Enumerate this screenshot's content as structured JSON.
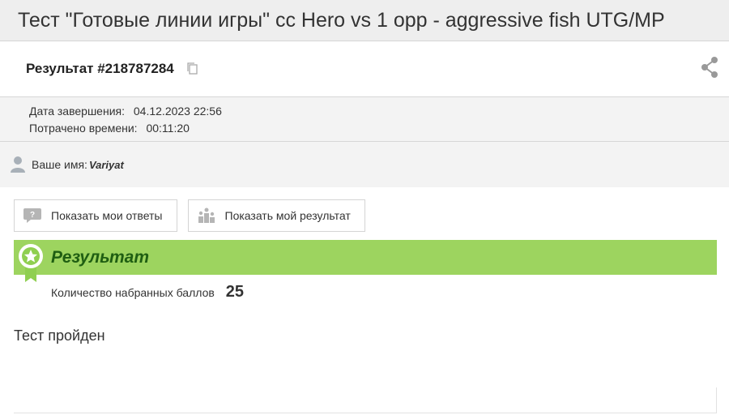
{
  "header": {
    "title": "Тест \"Готовые линии игры\" сс Hero vs 1 opp - aggressive fish UTG/MP"
  },
  "result": {
    "label": "Результат #218787284"
  },
  "meta": {
    "finish_label": "Дата завершения:",
    "finish_value": "04.12.2023 22:56",
    "spent_label": "Потрачено времени:",
    "spent_value": "00:11:20"
  },
  "user": {
    "label": "Ваше имя:",
    "name": "Variyat"
  },
  "buttons": {
    "show_answers": "Показать мои ответы",
    "show_result": "Показать мой результат"
  },
  "result_block": {
    "title": "Результат",
    "score_label": "Количество набранных баллов",
    "score_value": "25",
    "status": "Тест пройден"
  },
  "colors": {
    "accent_green": "#9dd45f",
    "title_green": "#1f5e12"
  },
  "icons": [
    "copy-icon",
    "share-icon",
    "user-icon",
    "question-chat-icon",
    "leaderboard-icon",
    "award-badge-icon"
  ]
}
